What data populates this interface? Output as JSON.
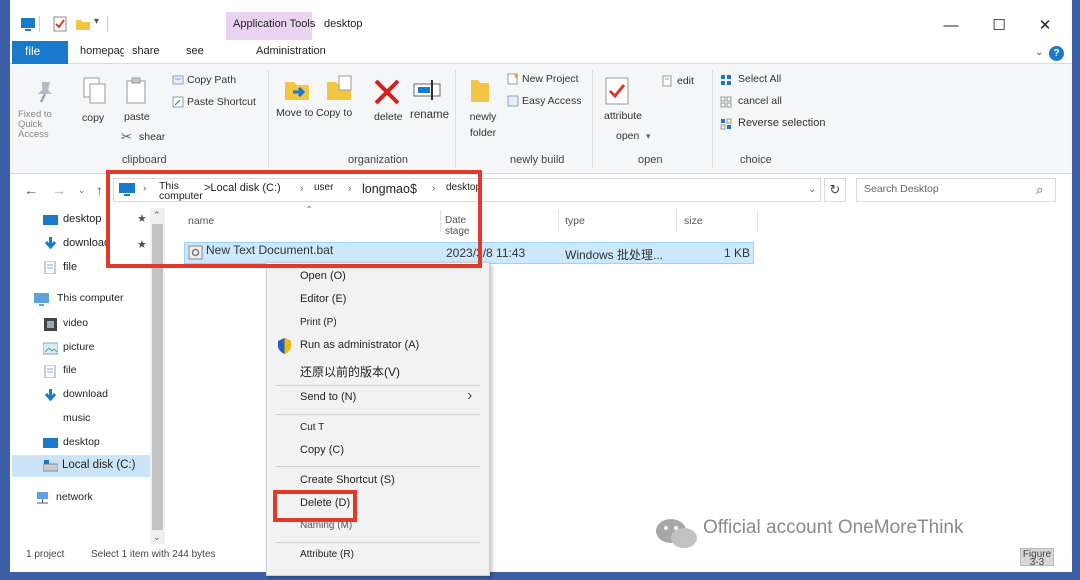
{
  "window": {
    "app_tools_label": "Application Tools",
    "title": "desktop",
    "controls": {
      "minimize": "—",
      "maximize": "☐",
      "close": "✕"
    }
  },
  "tabs": {
    "file": "file",
    "home": "homepage",
    "share": "share",
    "see": "see",
    "administration": "Administration"
  },
  "ribbon": {
    "clipboard": {
      "fixed_to_quick_access": "Fixed to Quick Access",
      "copy": "copy",
      "paste": "paste",
      "copy_path": "Copy Path",
      "paste_shortcut": "Paste Shortcut",
      "shear": "shear",
      "group": "clipboard"
    },
    "organization": {
      "move_to": "Move to",
      "copy_to": "Copy to",
      "delete": "delete",
      "rename": "rename",
      "group": "organization"
    },
    "new_build": {
      "newly_folder": "newly folder",
      "new_project": "New Project",
      "easy_access": "Easy Access",
      "group": "newly build"
    },
    "open": {
      "attribute": "attribute",
      "open": "open",
      "edit": "edit",
      "group": "open"
    },
    "choice": {
      "select_all": "Select All",
      "cancel_all": "cancel all",
      "reverse_selection": "Reverse selection",
      "group": "choice"
    }
  },
  "address": {
    "crumbs": [
      "This computer",
      ">Local disk (C:)",
      "user",
      "longmao$",
      "desktop"
    ],
    "search_placeholder": "Search Desktop"
  },
  "nav": {
    "quick": [
      "desktop",
      "download",
      "file"
    ],
    "this_computer": "This computer",
    "computer_items": [
      "video",
      "picture",
      "file",
      "download",
      "music",
      "desktop",
      "Local disk (C:)"
    ],
    "network": "network"
  },
  "list": {
    "headers": {
      "name": "name",
      "date": "Date stage",
      "type": "type",
      "size": "size"
    },
    "rows": [
      {
        "name": "New Text Document.bat",
        "date": "2023/3/8 11:43",
        "type": "Windows 批处理...",
        "size": "1 KB"
      }
    ]
  },
  "context_menu": {
    "open": "Open (O)",
    "editor": "Editor (E)",
    "print": "Print (P)",
    "run_as_admin": "Run as administrator (A)",
    "restore": "还原以前的版本(V)",
    "send_to": "Send to (N)",
    "cut": "Cut T",
    "copy": "Copy (C)",
    "create_shortcut": "Create Shortcut (S)",
    "delete": "Delete (D)",
    "naming": "Naming (M)",
    "attribute": "Attribute (R)"
  },
  "status": {
    "count": "1 project",
    "selection": "Select 1 item with 244 bytes"
  },
  "watermark": {
    "text": "Official account OneMoreThink",
    "figure": "Figure 3-3"
  },
  "colors": {
    "accent": "#1979ca",
    "selection": "#cce8ff",
    "annotation": "#e23a2a",
    "app_tools": "#ead3f0"
  }
}
